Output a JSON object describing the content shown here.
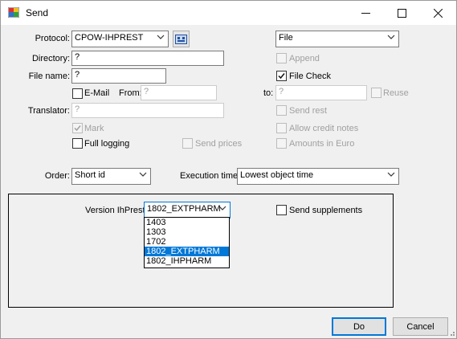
{
  "window": {
    "title": "Send"
  },
  "protocol": {
    "label": "Protocol:",
    "value": "CPOW-IHPREST"
  },
  "file_type": {
    "value": "File"
  },
  "directory": {
    "label": "Directory:",
    "value": "?"
  },
  "append": {
    "label": "Append",
    "checked": false
  },
  "file_name": {
    "label": "File name:",
    "value": "?"
  },
  "file_check": {
    "label": "File Check",
    "checked": true
  },
  "email": {
    "label": "E-Mail",
    "checked": false
  },
  "from": {
    "label": "From:",
    "value": "?"
  },
  "to": {
    "label": "to:",
    "value": "?"
  },
  "reuse": {
    "label": "Reuse",
    "checked": false
  },
  "translator": {
    "label": "Translator:",
    "value": "?"
  },
  "send_rest": {
    "label": "Send rest",
    "checked": false
  },
  "mark": {
    "label": "Mark",
    "checked": true
  },
  "allow_credit_notes": {
    "label": "Allow credit notes",
    "checked": false
  },
  "full_logging": {
    "label": "Full logging",
    "checked": false
  },
  "send_prices": {
    "label": "Send prices",
    "checked": false
  },
  "amounts_in_euro": {
    "label": "Amounts in Euro",
    "checked": false
  },
  "order": {
    "label": "Order:",
    "value": "Short id"
  },
  "execution_time": {
    "label": "Execution time:",
    "value": "Lowest object time"
  },
  "version": {
    "label": "Version IhPrest:",
    "value": "1802_EXTPHARM",
    "options": [
      "1403",
      "1303",
      "1702",
      "1802_EXTPHARM",
      "1802_IHPHARM"
    ],
    "selected_index": 3
  },
  "send_supplements": {
    "label": "Send supplements",
    "checked": false
  },
  "buttons": {
    "do": "Do",
    "cancel": "Cancel"
  },
  "colors": {
    "selection": "#0078d7",
    "title_bg": "#ffffff",
    "dialog_bg": "#f0f0f0"
  }
}
